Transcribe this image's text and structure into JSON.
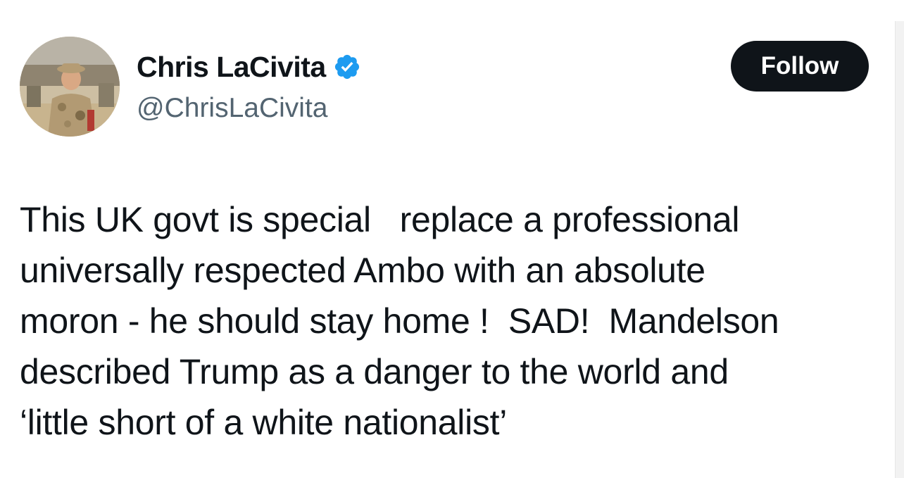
{
  "author": {
    "display_name": "Chris LaCivita",
    "handle": "@ChrisLaCivita",
    "verified": true,
    "verified_icon": "verified-badge-icon",
    "verified_color": "#1d9bf0"
  },
  "actions": {
    "follow_label": "Follow"
  },
  "tweet": {
    "lines": [
      "This UK govt is special   replace a professional",
      "universally respected Ambo with an absolute",
      "moron - he should stay home !  SAD!  Mandelson",
      "described Trump as a danger to the world and",
      "‘little short of a white nationalist’"
    ]
  },
  "colors": {
    "text": "#0f1419",
    "secondary_text": "#536471",
    "follow_bg": "#0f1419",
    "follow_text": "#ffffff"
  }
}
